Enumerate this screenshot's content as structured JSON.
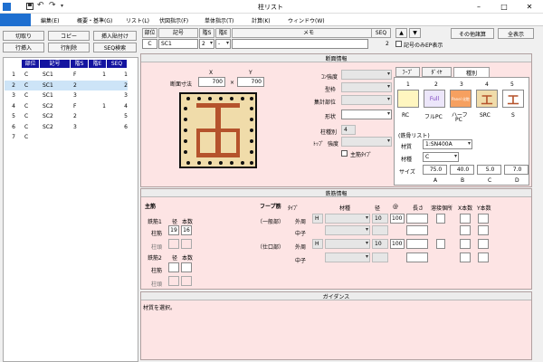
{
  "window": {
    "title": "柱リスト"
  },
  "menu": [
    "編集(E)",
    "概要・基準(G)",
    "リスト(L)",
    "伏図指示(F)",
    "単体指示(T)",
    "計算(K)",
    "ウィンドウ(W)"
  ],
  "toolbar": {
    "cut": "切取り",
    "copy": "コピー",
    "paste_insert": "挿入貼付け",
    "row_insert": "行挿入",
    "row_delete": "行削除",
    "seq_search": "SEQ検索"
  },
  "grid": {
    "headers": [
      "部位",
      "記号",
      "階S",
      "階E",
      "SEQ"
    ],
    "rows": [
      [
        "1",
        "C",
        "SC1",
        "F",
        "1",
        "1"
      ],
      [
        "2",
        "C",
        "SC1",
        "2",
        "",
        "2"
      ],
      [
        "3",
        "C",
        "SC1",
        "3",
        "",
        "3"
      ],
      [
        "4",
        "C",
        "SC2",
        "F",
        "1",
        "4"
      ],
      [
        "5",
        "C",
        "SC2",
        "2",
        "",
        "5"
      ],
      [
        "6",
        "C",
        "SC2",
        "3",
        "",
        "6"
      ],
      [
        "7",
        "C",
        "",
        "",
        "",
        ""
      ]
    ]
  },
  "editrow": {
    "h_part": "部位",
    "h_code": "記号",
    "h_fs": "階S",
    "h_fe": "階E",
    "h_memo": "メモ",
    "h_seq": "SEQ",
    "part": "C",
    "code": "SC1",
    "fs": "2",
    "fe": "-",
    "memo": "",
    "seq": "2"
  },
  "ctrl": {
    "print_only": "記号のみEP表示",
    "others": "その他諸算",
    "show_all": "全表示"
  },
  "section": {
    "title": "断面情報",
    "dim_label": "断面寸法",
    "x_label": "X",
    "y_label": "Y",
    "x": "700",
    "y": "700",
    "times": "×",
    "concrete": "ｺﾝ強度",
    "mold": "型枠",
    "calc_part": "集計部位",
    "shape": "形状",
    "col_type": "柱種別",
    "col_type_val": "4",
    "top": "ﾄｯﾌﾟ",
    "strength": "強度",
    "main_type": "主筋ﾀｲﾌﾟ"
  },
  "tabs": [
    "ﾌｰﾌﾟ",
    "ﾀﾞｲﾔ",
    "種別"
  ],
  "kinds": {
    "n1": "1",
    "n2": "2",
    "n3": "3",
    "n4": "4",
    "n5": "5",
    "rc": "RC",
    "full": "Full",
    "fullpc": "フルPC",
    "panel": "Panel 化粧",
    "half": "ハーフ",
    "pc": "PC",
    "src": "SRC",
    "s": "S"
  },
  "steel": {
    "list_label": "(鉄骨リスト)",
    "material_label": "材質",
    "material": "1:SN400A",
    "mat2_label": "材種",
    "mat2": "C",
    "size_label": "サイズ",
    "a": "75.0",
    "b": "40.0",
    "c": "5.0",
    "d": "7.0",
    "la": "A",
    "lb": "B",
    "lc": "C",
    "ld": "D"
  },
  "rebar": {
    "title": "鉄筋情報",
    "main": "主筋",
    "main1": "鉄筋1",
    "diam": "径",
    "count": "本数",
    "col": "柱筋",
    "col_top": "柱頭",
    "main2": "鉄筋2",
    "diam_v": "19",
    "count_v": "16",
    "hoop": "フープ筋",
    "type": "ﾀｲﾌﾟ",
    "material": "材種",
    "dia": "径",
    "at": "@",
    "len": "長さ",
    "weld": "溶接個所",
    "xcount": "X本数",
    "ycount": "Y本数",
    "general": "（一般部）",
    "joint": "（仕口部）",
    "outer": "外周",
    "inner": "中子",
    "h": "H",
    "d1": "10",
    "p1": "100",
    "d2": "10",
    "p2": "100"
  },
  "guidance": {
    "title": "ガイダンス",
    "text": "材質を選択。"
  },
  "colors": {
    "accent": "#1e6fd0",
    "pink": "#fde4e4",
    "grid_header": "#1414a0",
    "selected": "#cde4f7"
  },
  "icons": [
    "save-icon",
    "undo-icon",
    "redo-icon"
  ]
}
